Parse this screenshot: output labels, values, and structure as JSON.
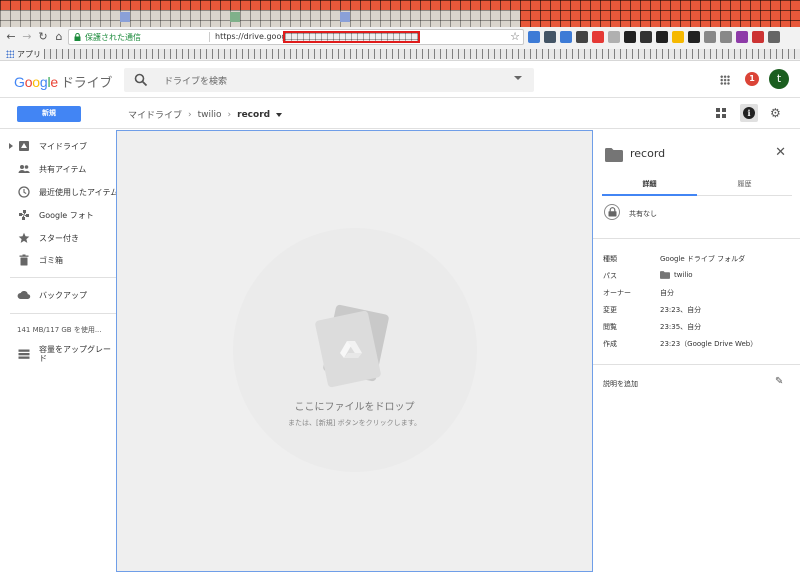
{
  "browser": {
    "secure_label": "保護された通信",
    "url_prefix": "https://drive.google.com/drive/folders/",
    "bookmarks_apps": "アプリ",
    "extension_colors": [
      "#3d7bd6",
      "#445566",
      "#3d7bd6",
      "#444444",
      "#e53935",
      "#b0b0b0",
      "#222222",
      "#333333",
      "#222222",
      "#f5b800",
      "#222222",
      "#888888",
      "#888888",
      "#8e3ba8",
      "#cc3333",
      "#666666"
    ]
  },
  "header": {
    "logo_google": "Google",
    "logo_drive": "ドライブ",
    "search_placeholder": "ドライブを検索",
    "notifications_count": "1",
    "avatar_letter": "t"
  },
  "toolbar": {
    "new_button": "新規",
    "breadcrumb": {
      "root": "マイドライブ",
      "parent": "twilio",
      "current": "record"
    }
  },
  "sidebar": {
    "items": [
      {
        "label": "マイドライブ"
      },
      {
        "label": "共有アイテム"
      },
      {
        "label": "最近使用したアイテム"
      },
      {
        "label": "Google フォト"
      },
      {
        "label": "スター付き"
      },
      {
        "label": "ゴミ箱"
      },
      {
        "label": "バックアップ"
      }
    ],
    "storage": "141 MB/117 GB を使用...",
    "upgrade_line1": "容量をアップグレー",
    "upgrade_line2": "ド"
  },
  "dropzone": {
    "title": "ここにファイルをドロップ",
    "subtitle": "または、[新規] ボタンをクリックします。"
  },
  "details": {
    "title": "record",
    "tabs": [
      "詳細",
      "履歴"
    ],
    "sharing": "共有なし",
    "properties": [
      {
        "key": "種類",
        "value": "Google ドライブ フォルダ"
      },
      {
        "key": "パス",
        "value": "twilio"
      },
      {
        "key": "オーナー",
        "value": "自分"
      },
      {
        "key": "変更",
        "value": "23:23、自分"
      },
      {
        "key": "閲覧",
        "value": "23:35、自分"
      },
      {
        "key": "作成",
        "value": "23:23（Google Drive Web）"
      }
    ],
    "add_description": "説明を追加"
  },
  "colors": {
    "accent": "#4285f4",
    "notif": "#db4437",
    "avatar": "#1b5e20"
  }
}
